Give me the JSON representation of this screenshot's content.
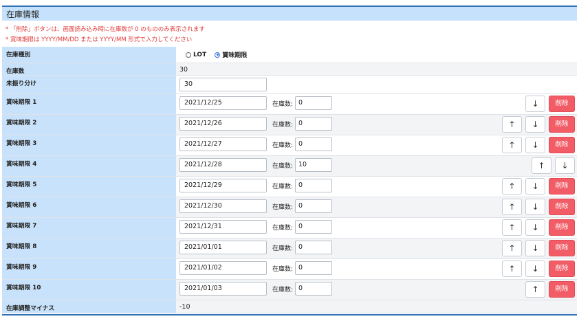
{
  "section": {
    "title": "在庫情報"
  },
  "notes": [
    "* 「削除」ボタンは、画面読み込み時に在庫数が 0 のもののみ表示されます",
    "* 賞味期限は YYYY/MM/DD または YYYY/MM 形式で入力してください"
  ],
  "stock_type": {
    "label": "在庫種別",
    "options": [
      {
        "label": "LOT",
        "selected": false
      },
      {
        "label": "賞味期限",
        "selected": true
      }
    ]
  },
  "stock_count": {
    "label": "在庫数",
    "value": "30"
  },
  "unassigned": {
    "label": "未振り分け",
    "value": "30"
  },
  "stock_label": "在庫数:",
  "icons": {
    "up": "↑",
    "down": "↓"
  },
  "delete_label": "削除",
  "rows": [
    {
      "label": "賞味期限 1",
      "date": "2021/12/25",
      "stock": "0",
      "up": false,
      "down": true,
      "del": true
    },
    {
      "label": "賞味期限 2",
      "date": "2021/12/26",
      "stock": "0",
      "up": true,
      "down": true,
      "del": true
    },
    {
      "label": "賞味期限 3",
      "date": "2021/12/27",
      "stock": "0",
      "up": true,
      "down": true,
      "del": true
    },
    {
      "label": "賞味期限 4",
      "date": "2021/12/28",
      "stock": "10",
      "up": true,
      "down": true,
      "del": false
    },
    {
      "label": "賞味期限 5",
      "date": "2021/12/29",
      "stock": "0",
      "up": true,
      "down": true,
      "del": true
    },
    {
      "label": "賞味期限 6",
      "date": "2021/12/30",
      "stock": "0",
      "up": true,
      "down": true,
      "del": true
    },
    {
      "label": "賞味期限 7",
      "date": "2021/12/31",
      "stock": "0",
      "up": true,
      "down": true,
      "del": true
    },
    {
      "label": "賞味期限 8",
      "date": "2021/01/01",
      "stock": "0",
      "up": true,
      "down": true,
      "del": true
    },
    {
      "label": "賞味期限 9",
      "date": "2021/01/02",
      "stock": "0",
      "up": true,
      "down": true,
      "del": true
    },
    {
      "label": "賞味期限 10",
      "date": "2021/01/03",
      "stock": "0",
      "up": true,
      "down": false,
      "del": true
    }
  ],
  "adjust_minus": {
    "label": "在庫調整マイナス",
    "value": "-10"
  },
  "colors": {
    "accent": "#2f72b6",
    "label_bg": "#c9e2fb",
    "note_red": "#e03a3a",
    "delete_bg": "#f25c66"
  }
}
